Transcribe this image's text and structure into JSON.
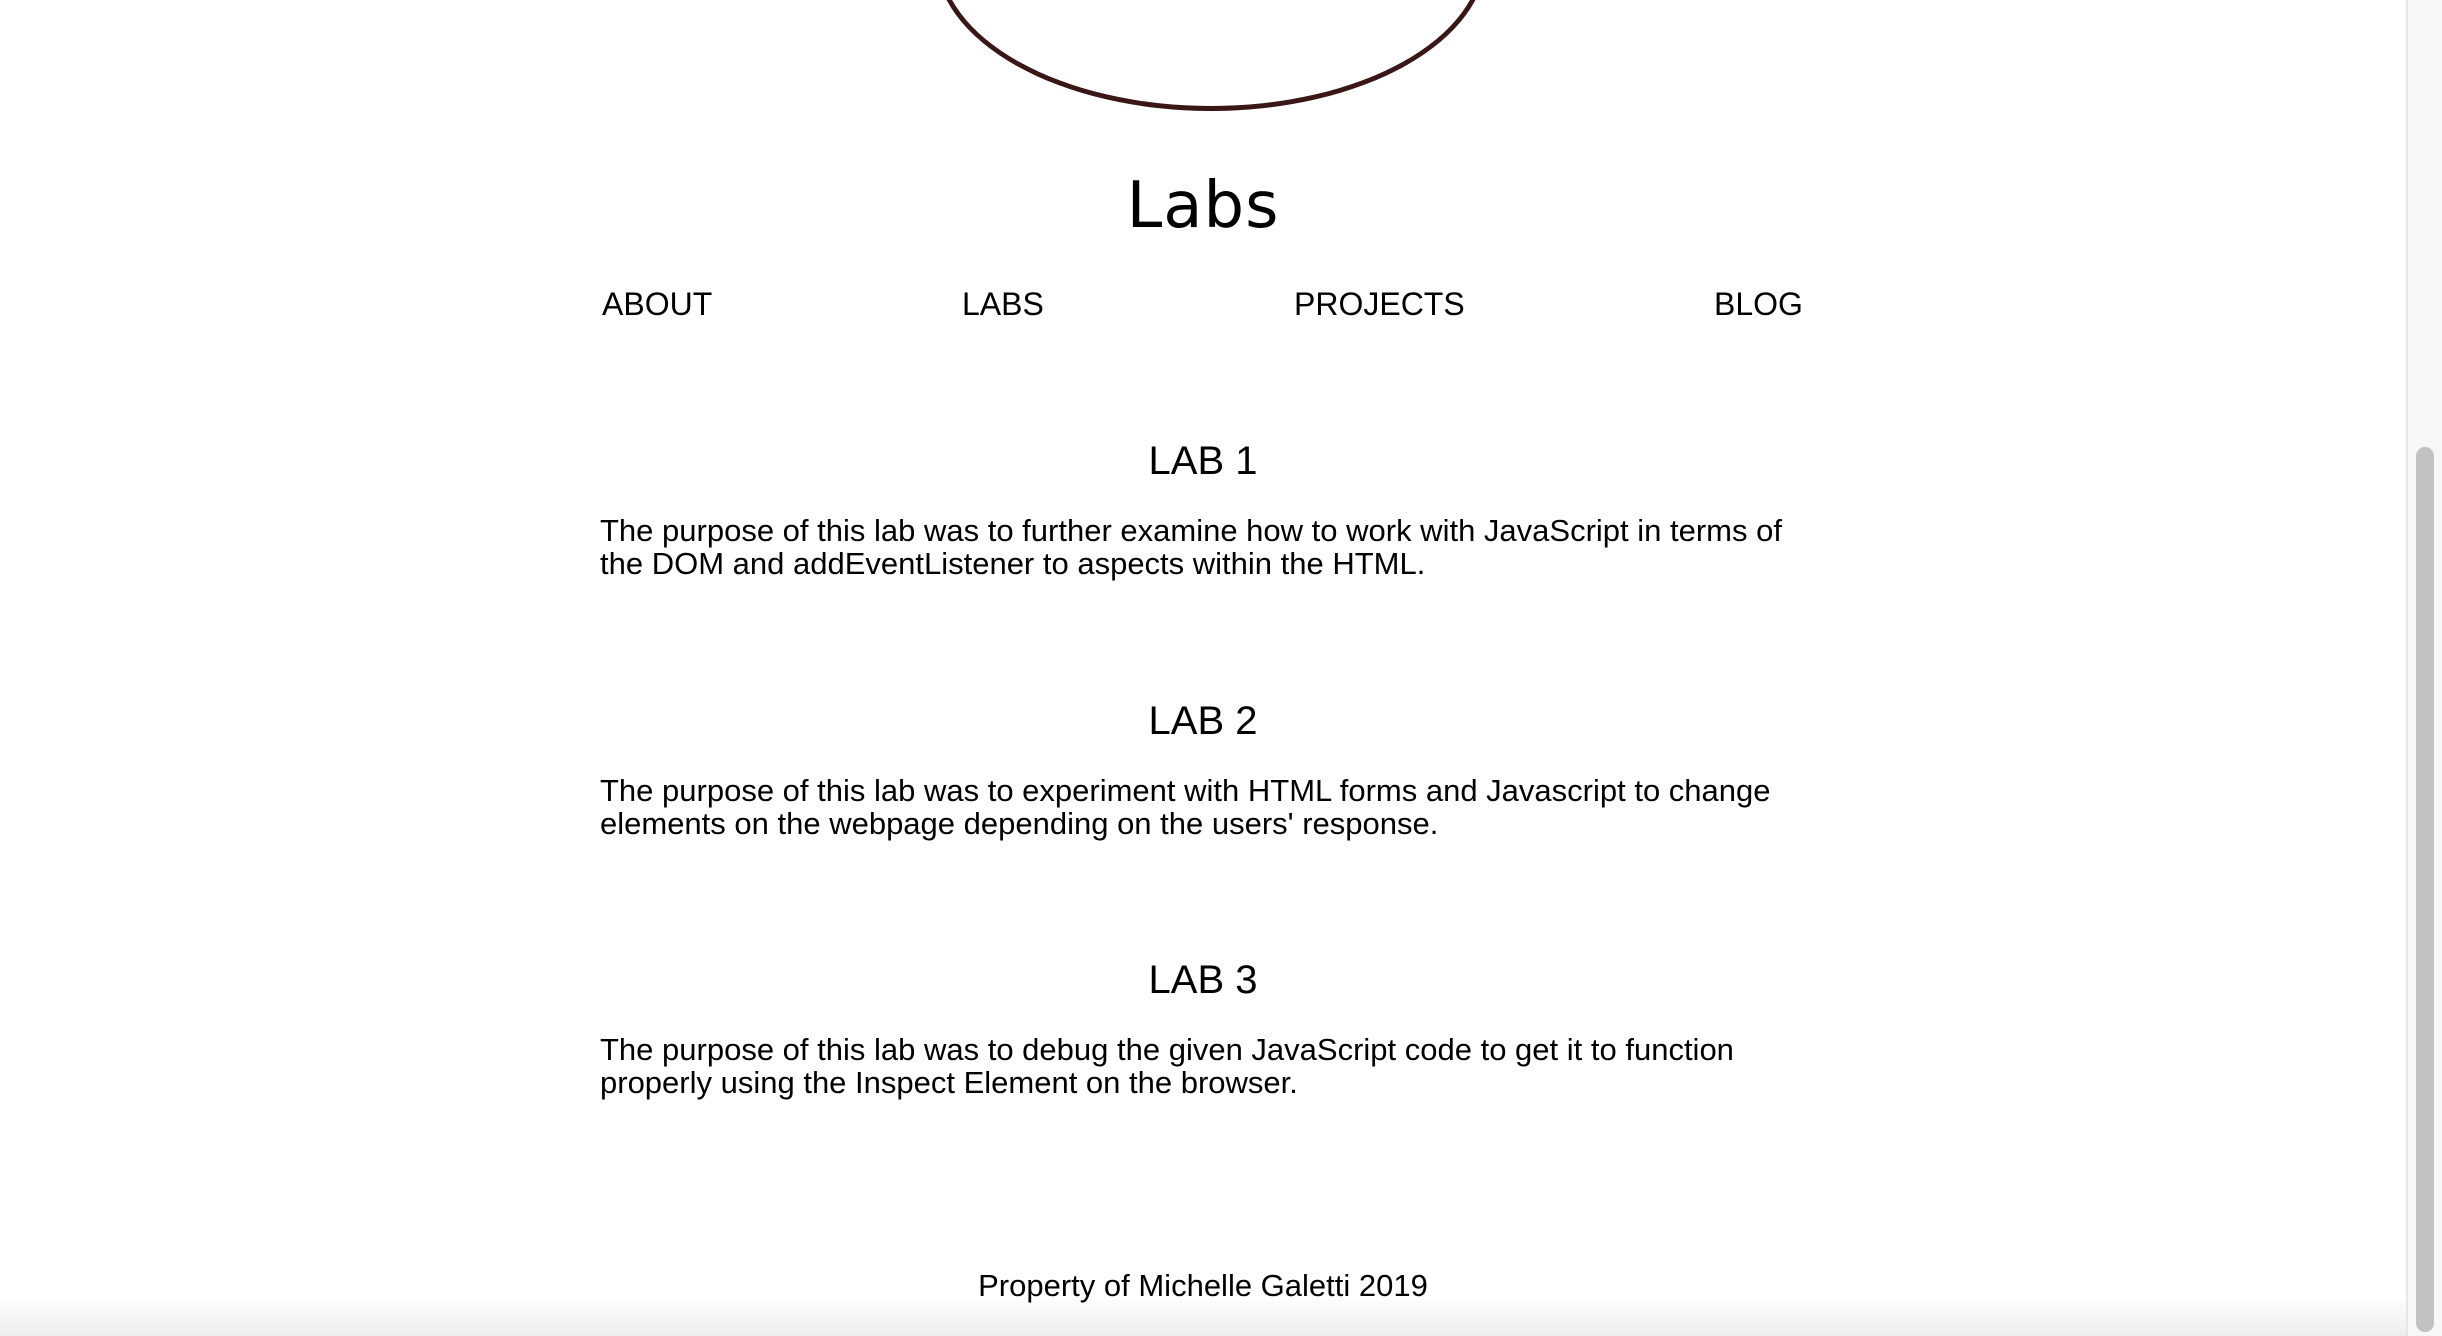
{
  "header": {
    "title": "Labs"
  },
  "nav": {
    "items": [
      {
        "label": "ABOUT"
      },
      {
        "label": "LABS"
      },
      {
        "label": "PROJECTS"
      },
      {
        "label": "BLOG"
      }
    ]
  },
  "labs": [
    {
      "heading": "LAB 1",
      "description": "The purpose of this lab was to further examine how to work with JavaScript in terms of the DOM and addEventListener to aspects within the HTML."
    },
    {
      "heading": "LAB 2",
      "description": "The purpose of this lab was to experiment with HTML forms and Javascript to change elements on the webpage depending on the users' response."
    },
    {
      "heading": "LAB 3",
      "description": "The purpose of this lab was to debug the given JavaScript code to get it to function properly using the Inspect Element on the browser."
    }
  ],
  "footer": {
    "text": "Property of Michelle Galetti 2019"
  },
  "colors": {
    "circle_border": "#3a1616",
    "text": "#000000",
    "background": "#ffffff"
  }
}
